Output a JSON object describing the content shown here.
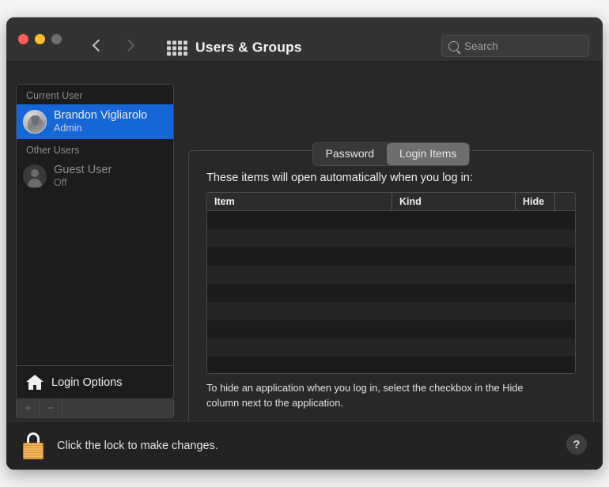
{
  "window": {
    "title": "Users & Groups",
    "traffic_lights": [
      "close",
      "minimize",
      "zoom"
    ],
    "back_label": "‹",
    "forward_label": "›",
    "grid_label": "show-all"
  },
  "search": {
    "placeholder": "Search",
    "value": ""
  },
  "sidebar": {
    "groups": [
      {
        "label": "Current User",
        "rows": [
          {
            "name": "Brandon Vigliarolo",
            "sub": "Admin",
            "selected": true,
            "avatar": "user-photo"
          }
        ]
      },
      {
        "label": "Other Users",
        "rows": [
          {
            "name": "Guest User",
            "sub": "Off",
            "selected": false,
            "avatar": "generic-person"
          }
        ]
      }
    ],
    "login_options_label": "Login Options",
    "add_label": "+",
    "remove_label": "−"
  },
  "tabs": [
    {
      "label": "Password",
      "active": false
    },
    {
      "label": "Login Items",
      "active": true
    }
  ],
  "main": {
    "headline": "These items will open automatically when you log in:",
    "table": {
      "columns": [
        "Item",
        "Kind",
        "Hide"
      ],
      "rows": [],
      "empty_row_count": 9
    },
    "hint": "To hide an application when you log in, select the checkbox in the Hide column next to the application.",
    "add_label": "+",
    "remove_label": "−"
  },
  "footer": {
    "lock_text": "Click the lock to make changes.",
    "lock_state": "locked",
    "help_label": "?"
  },
  "colors": {
    "selection_blue": "#1566d6",
    "window_bg": "#282828",
    "titlebar_bg": "#333333",
    "sidebar_bg": "#1c1c1c",
    "lock_gold": "#f2b95a",
    "close_red": "#ff5f57",
    "minimize_yellow": "#febc2e",
    "zoom_gray": "#6e6e6e"
  }
}
